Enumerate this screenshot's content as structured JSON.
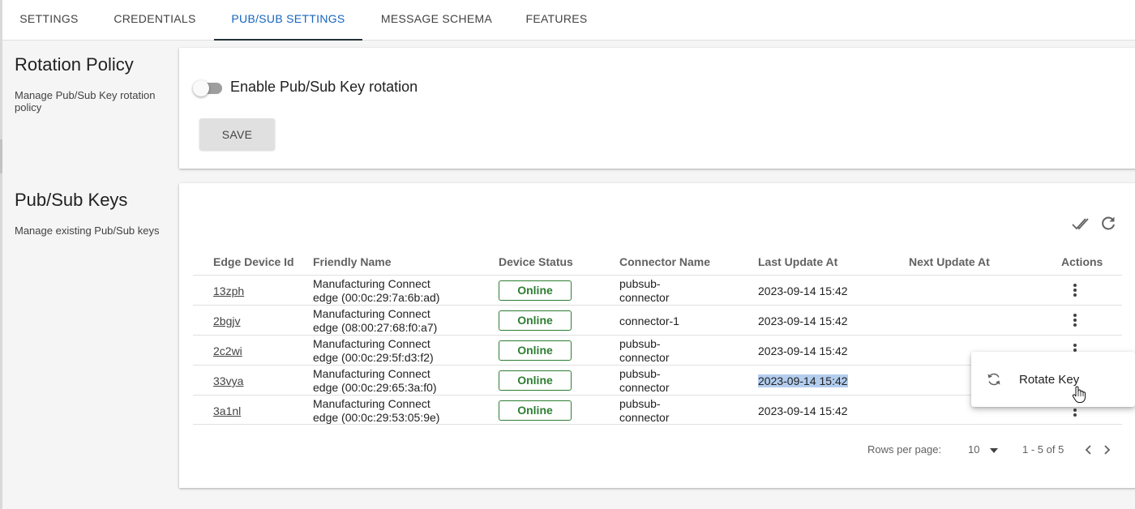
{
  "tabs": [
    {
      "label": "SETTINGS",
      "active": false
    },
    {
      "label": "CREDENTIALS",
      "active": false
    },
    {
      "label": "PUB/SUB SETTINGS",
      "active": true
    },
    {
      "label": "MESSAGE SCHEMA",
      "active": false
    },
    {
      "label": "FEATURES",
      "active": false
    }
  ],
  "rotation": {
    "title": "Rotation Policy",
    "description": "Manage Pub/Sub Key rotation policy",
    "toggle_label": "Enable Pub/Sub Key rotation",
    "toggle_on": false,
    "save_label": "SAVE"
  },
  "keys": {
    "title": "Pub/Sub Keys",
    "description": "Manage existing Pub/Sub keys",
    "toolbar": {
      "check_icon": "double-check-icon",
      "refresh_icon": "refresh-icon"
    },
    "columns": [
      "Edge Device Id",
      "Friendly Name",
      "Device Status",
      "Connector Name",
      "Last Update At",
      "Next Update At",
      "Actions"
    ],
    "rows": [
      {
        "id": "13zph",
        "name1": "Manufacturing Connect",
        "name2": "edge (00:0c:29:7a:6b:ad)",
        "status": "Online",
        "conn1": "pubsub-",
        "conn2": "connector",
        "last_update": "2023-09-14 15:42",
        "next_update": ""
      },
      {
        "id": "2bgjv",
        "name1": "Manufacturing Connect",
        "name2": "edge (08:00:27:68:f0:a7)",
        "status": "Online",
        "conn1": "connector-1",
        "conn2": "",
        "last_update": "2023-09-14 15:42",
        "next_update": ""
      },
      {
        "id": "2c2wi",
        "name1": "Manufacturing Connect",
        "name2": "edge (00:0c:29:5f:d3:f2)",
        "status": "Online",
        "conn1": "pubsub-",
        "conn2": "connector",
        "last_update": "2023-09-14 15:42",
        "next_update": ""
      },
      {
        "id": "33vya",
        "name1": "Manufacturing Connect",
        "name2": "edge (00:0c:29:65:3a:f0)",
        "status": "Online",
        "conn1": "pubsub-",
        "conn2": "connector",
        "last_update": "2023-09-14 15:42",
        "next_update": ""
      },
      {
        "id": "3a1nl",
        "name1": "Manufacturing Connect",
        "name2": "edge (00:0c:29:53:05:9e)",
        "status": "Online",
        "conn1": "pubsub-",
        "conn2": "connector",
        "last_update": "2023-09-14 15:42",
        "next_update": ""
      }
    ],
    "pagination": {
      "rows_per_page_label": "Rows per page:",
      "rows_per_page_value": "10",
      "range": "1 - 5 of 5"
    }
  },
  "context_menu": {
    "item_label": "Rotate Key",
    "item_icon": "rotate-icon"
  },
  "colors": {
    "accent": "#1565c0",
    "online": "#2e7d32",
    "highlight": "#b3cdee"
  }
}
